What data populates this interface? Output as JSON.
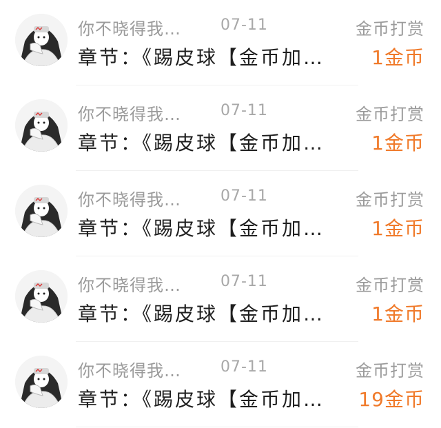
{
  "colors": {
    "accent": "#f07a2a",
    "secondary_text": "#9b9b9b",
    "primary_text": "#1f1f1f"
  },
  "records": [
    {
      "name": "你不晓得我…",
      "date": "07-11",
      "type": "金币打赏",
      "chapter": "章节：《踢皮球【金币加…",
      "amount": "1金币",
      "avatar_icon": "user-avatar-icon"
    },
    {
      "name": "你不晓得我…",
      "date": "07-11",
      "type": "金币打赏",
      "chapter": "章节：《踢皮球【金币加…",
      "amount": "1金币",
      "avatar_icon": "user-avatar-icon"
    },
    {
      "name": "你不晓得我…",
      "date": "07-11",
      "type": "金币打赏",
      "chapter": "章节：《踢皮球【金币加…",
      "amount": "1金币",
      "avatar_icon": "user-avatar-icon"
    },
    {
      "name": "你不晓得我…",
      "date": "07-11",
      "type": "金币打赏",
      "chapter": "章节：《踢皮球【金币加…",
      "amount": "1金币",
      "avatar_icon": "user-avatar-icon"
    },
    {
      "name": "你不晓得我…",
      "date": "07-11",
      "type": "金币打赏",
      "chapter": "章节：《踢皮球【金币加…",
      "amount": "19金币",
      "avatar_icon": "user-avatar-icon"
    }
  ]
}
